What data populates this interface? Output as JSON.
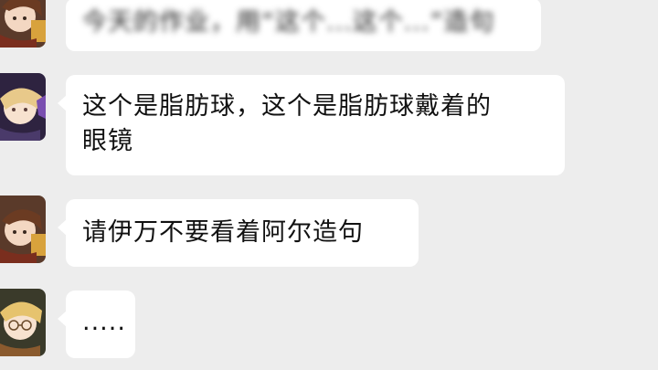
{
  "messages": [
    {
      "sender_avatar": "brown-haired-character-avatar-icon",
      "lines": [
        "今天的作业，用“这个...这个...”造句"
      ],
      "blurred": true
    },
    {
      "sender_avatar": "blonde-character-avatar-icon",
      "lines": [
        "这个是脂肪球，这个是脂肪球戴着的",
        "眼镜"
      ],
      "blurred": false
    },
    {
      "sender_avatar": "brown-haired-character-avatar-icon",
      "lines": [
        "请伊万不要看着阿尔造句"
      ],
      "blurred": false
    },
    {
      "sender_avatar": "blonde-glasses-character-avatar-icon",
      "lines": [
        "....."
      ],
      "blurred": false
    }
  ],
  "colors": {
    "background": "#ededed",
    "bubble": "#ffffff",
    "text": "#111111"
  }
}
